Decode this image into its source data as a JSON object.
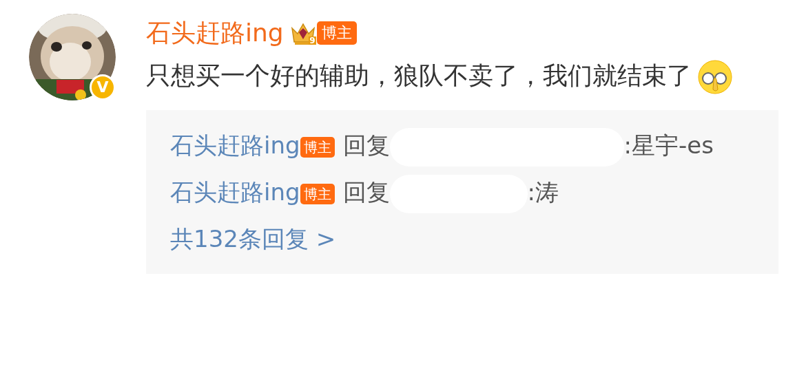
{
  "comment": {
    "author": "石头赶路ing",
    "level": "9",
    "role_badge": "博主",
    "verified_mark": "V",
    "text": "只想买一个好的辅助，狼队不卖了，我们就结束了"
  },
  "replies": [
    {
      "author": "石头赶路ing",
      "role_badge": "博主",
      "verb": "回复",
      "text": ":星宇-es"
    },
    {
      "author": "石头赶路ing",
      "role_badge": "博主",
      "verb": "回复",
      "text": ":涛"
    }
  ],
  "more_replies": "共132条回复 >"
}
